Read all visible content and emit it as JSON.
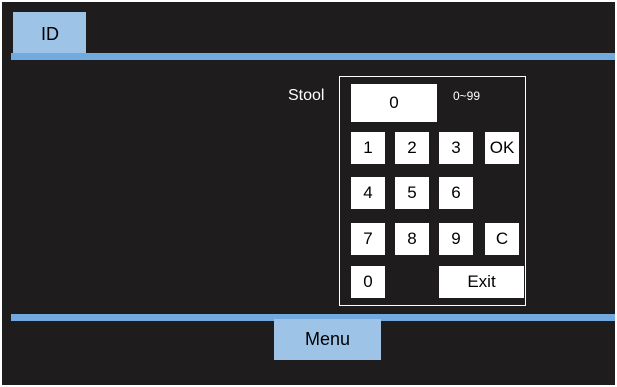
{
  "tab": {
    "label": "ID"
  },
  "field": {
    "label": "Stool",
    "value": "0",
    "range": "0~99"
  },
  "keys": {
    "k1": "1",
    "k2": "2",
    "k3": "3",
    "ok": "OK",
    "k4": "4",
    "k5": "5",
    "k6": "6",
    "k7": "7",
    "k8": "8",
    "k9": "9",
    "clear": "C",
    "k0": "0",
    "exit": "Exit"
  },
  "footer": {
    "menu_label": "Menu"
  },
  "colors": {
    "background": "#1e1c1d",
    "accent_tab": "#9dc3e6",
    "accent_bar": "#70aadf",
    "key": "#ffffff"
  }
}
